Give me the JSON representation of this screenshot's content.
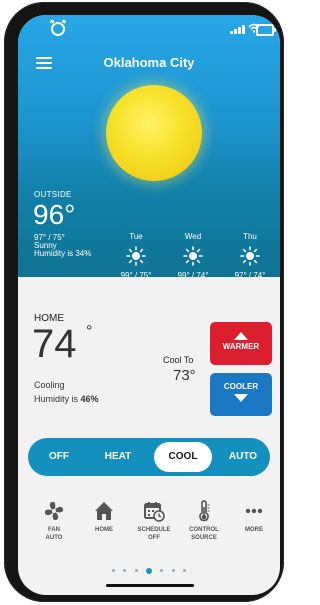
{
  "header": {
    "city": "Oklahoma City"
  },
  "outside": {
    "label": "OUTSIDE",
    "temp": "96°",
    "hi_lo": "97° / 75°",
    "condition": "Sunny",
    "humidity": "Humidity is 34%"
  },
  "forecast": [
    {
      "day": "Tue",
      "range": "99° / 75°",
      "icon": "sun-icon"
    },
    {
      "day": "Wed",
      "range": "99° / 74°",
      "icon": "sun-icon"
    },
    {
      "day": "Thu",
      "range": "97° / 74°",
      "icon": "sun-icon"
    }
  ],
  "home": {
    "label": "HOME",
    "temp": "74",
    "degree": "°",
    "status": "Cooling",
    "humidity_prefix": "Humidity is ",
    "humidity_value": "46%",
    "cool_to_label": "Cool To",
    "setpoint": "73°"
  },
  "buttons": {
    "warmer": "WARMER",
    "cooler": "COOLER"
  },
  "modes": {
    "items": [
      "OFF",
      "HEAT",
      "COOL",
      "AUTO"
    ],
    "active": "COOL"
  },
  "bottom_nav": [
    {
      "line1": "FAN",
      "line2": "AUTO",
      "icon": "fan-icon"
    },
    {
      "line1": "HOME",
      "line2": "",
      "icon": "home-icon"
    },
    {
      "line1": "SCHEDULE",
      "line2": "OFF",
      "icon": "calendar-clock-icon"
    },
    {
      "line1": "CONTROL",
      "line2": "SOURCE",
      "icon": "thermometer-icon"
    },
    {
      "line1": "MORE",
      "line2": "",
      "icon": "more-dots-icon"
    }
  ],
  "colors": {
    "warmer": "#dc1f2e",
    "cooler": "#1a78c4",
    "mode_bar": "#1390bd",
    "sun": "#f7e42c"
  }
}
